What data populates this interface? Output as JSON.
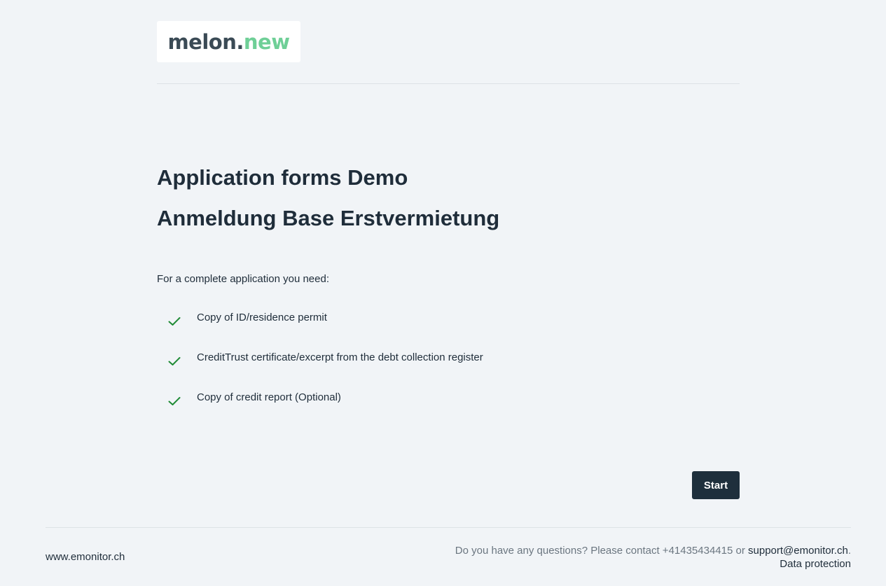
{
  "logo": {
    "part1": "melon",
    "dot": ".",
    "part2": "new",
    "color_main": "#3a4a55",
    "color_accent": "#6fcf97"
  },
  "main": {
    "title": "Application forms Demo",
    "subtitle": "Anmeldung Base Erstvermietung",
    "intro": "For a complete application you need:",
    "requirements": [
      {
        "label": "Copy of ID/residence permit",
        "icon": "check-icon"
      },
      {
        "label": "CreditTrust certificate/excerpt from the debt collection register",
        "icon": "check-icon"
      },
      {
        "label": "Copy of credit report (Optional)",
        "icon": "check-icon"
      }
    ],
    "start_label": "Start"
  },
  "footer": {
    "website": "www.emonitor.ch",
    "contact_prefix": "Do you have any questions? Please contact +41435434415 or ",
    "email": "support@emonitor.ch",
    "period": ".",
    "data_protection": "Data protection"
  },
  "colors": {
    "background": "#f1f4f7",
    "text": "#1f2d3a",
    "button_bg": "#1e2f3c",
    "check": "#1e8a34",
    "muted": "#6b7680"
  }
}
